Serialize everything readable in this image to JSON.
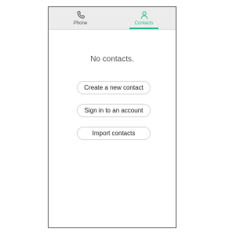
{
  "tabs": [
    {
      "label": "Phone",
      "icon": "phone-icon",
      "selected": false
    },
    {
      "label": "Contacts",
      "icon": "person-icon",
      "selected": true
    }
  ],
  "colors": {
    "accent": "#2bbf88",
    "tab_bar": "#ececec",
    "text_muted": "#555555"
  },
  "empty_state": {
    "message": "No contacts."
  },
  "actions": {
    "create_label": "Create a new contact",
    "signin_label": "Sign in to an account",
    "import_label": "Import contacts"
  }
}
